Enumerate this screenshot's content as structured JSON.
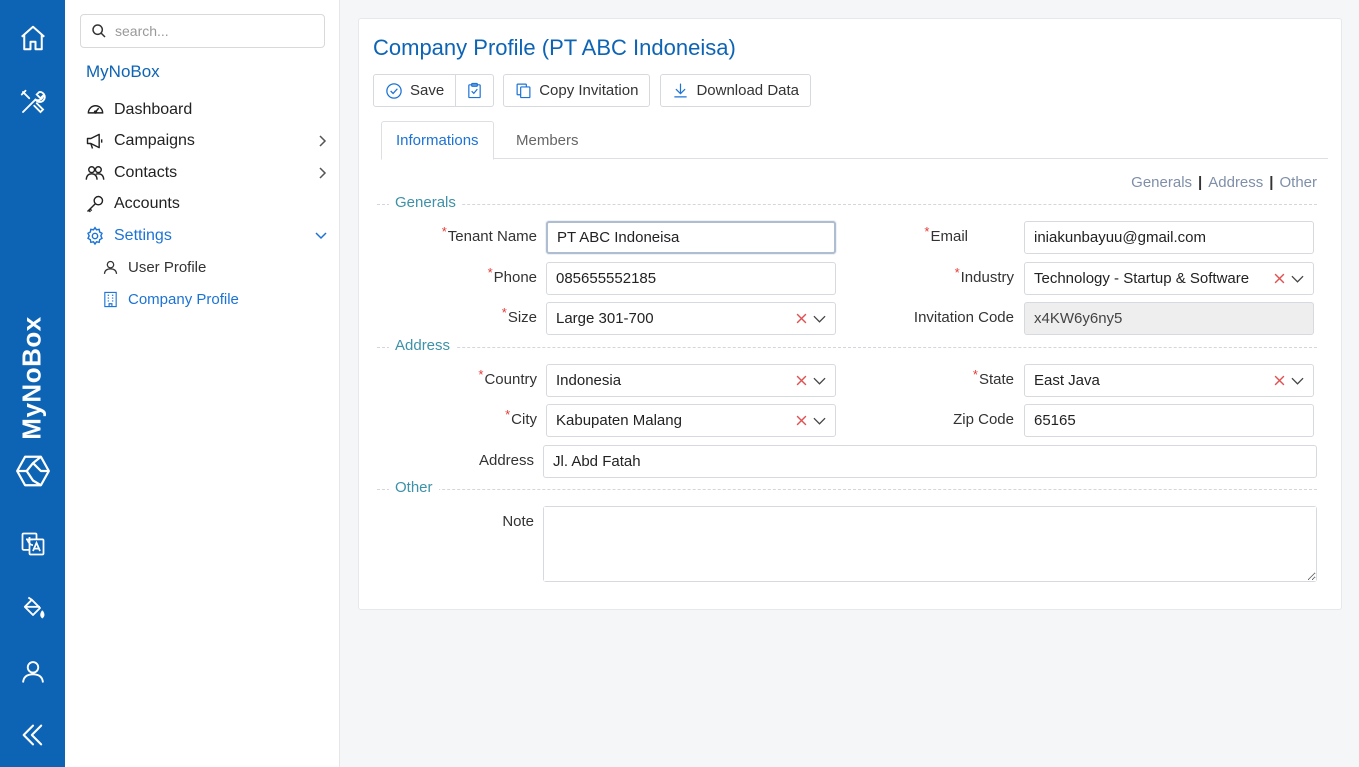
{
  "rail": {
    "brand": "MyNoBox",
    "icons": [
      "home-icon",
      "tools-icon",
      "translate-icon",
      "paint-bucket-icon",
      "user-icon",
      "collapse-icon"
    ]
  },
  "sidebar": {
    "search_placeholder": "search...",
    "app_name": "MyNoBox",
    "items": [
      {
        "label": "Dashboard",
        "icon": "dashboard-icon"
      },
      {
        "label": "Campaigns",
        "icon": "megaphone-icon"
      },
      {
        "label": "Contacts",
        "icon": "contacts-icon"
      },
      {
        "label": "Accounts",
        "icon": "key-icon"
      },
      {
        "label": "Settings",
        "icon": "gear-icon"
      }
    ],
    "subitems": [
      {
        "label": "User Profile",
        "icon": "user-icon"
      },
      {
        "label": "Company Profile",
        "icon": "building-icon"
      }
    ]
  },
  "page": {
    "title": "Company Profile (PT ABC Indoneisa)",
    "toolbar": {
      "save": "Save",
      "copy_invitation": "Copy Invitation",
      "download_data": "Download Data"
    },
    "tabs": [
      "Informations",
      "Members"
    ],
    "anchors": [
      "Generals",
      "Address",
      "Other"
    ],
    "sections": {
      "generals": "Generals",
      "address": "Address",
      "other": "Other"
    },
    "fields": {
      "tenant_name": {
        "label": "Tenant Name",
        "value": "PT ABC Indoneisa"
      },
      "email": {
        "label": "Email",
        "value": "iniakunbayuu@gmail.com"
      },
      "phone": {
        "label": "Phone",
        "value": "085655552185"
      },
      "industry": {
        "label": "Industry",
        "value": "Technology - Startup & Software"
      },
      "size": {
        "label": "Size",
        "value": "Large 301-700"
      },
      "invitation_code": {
        "label": "Invitation Code",
        "value": "x4KW6y6ny5"
      },
      "country": {
        "label": "Country",
        "value": "Indonesia"
      },
      "state": {
        "label": "State",
        "value": "East Java"
      },
      "city": {
        "label": "City",
        "value": "Kabupaten Malang"
      },
      "zip_code": {
        "label": "Zip Code",
        "value": "65165"
      },
      "address": {
        "label": "Address",
        "value": "Jl. Abd Fatah"
      },
      "note": {
        "label": "Note",
        "value": ""
      }
    }
  },
  "colors": {
    "rail": "#0d64b5",
    "accent": "#1c73d6",
    "section": "#3d91a8",
    "required": "#e53935"
  }
}
